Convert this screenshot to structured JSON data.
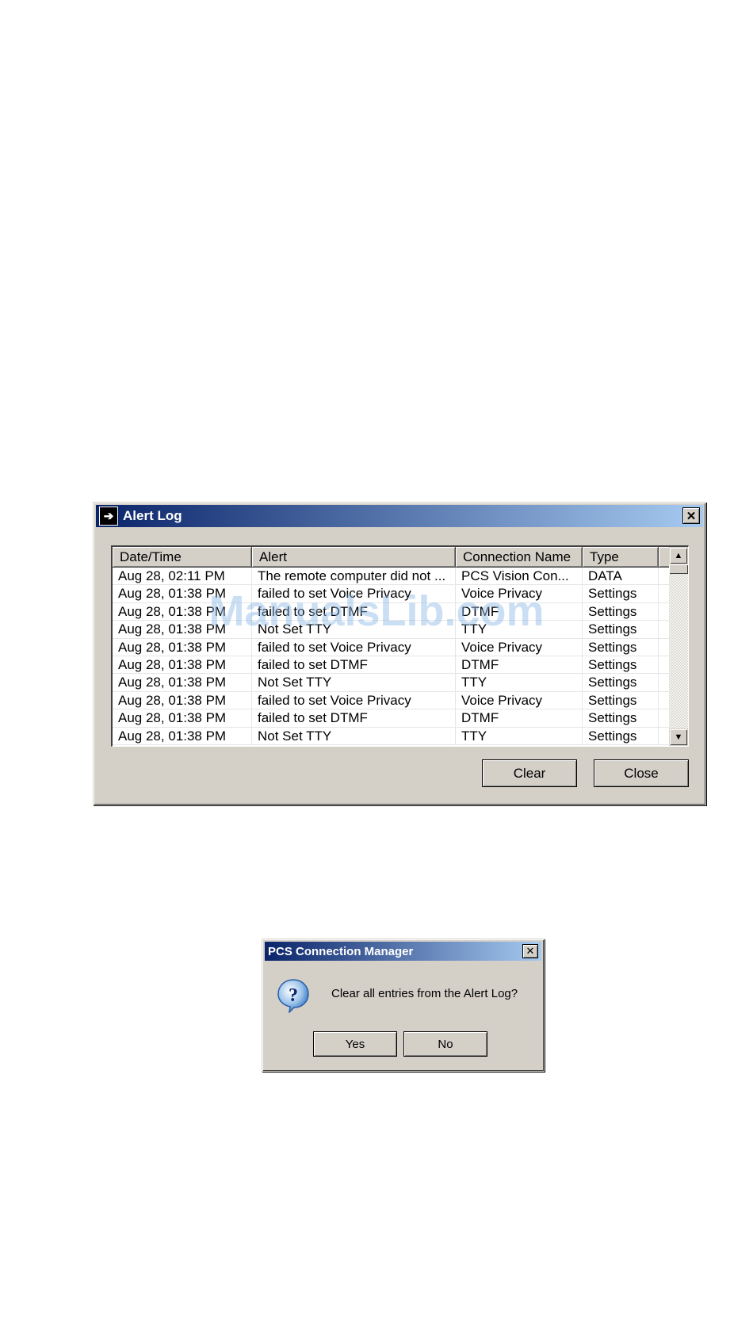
{
  "alert_log": {
    "title": "Alert Log",
    "close_glyph": "✕",
    "columns": [
      "Date/Time",
      "Alert",
      "Connection Name",
      "Type"
    ],
    "rows": [
      [
        "Aug  28, 02:11 PM",
        "The remote computer did not ...",
        "PCS Vision Con...",
        "DATA"
      ],
      [
        "Aug  28, 01:38 PM",
        "failed to set Voice Privacy",
        "Voice Privacy",
        "Settings"
      ],
      [
        "Aug  28, 01:38 PM",
        "failed to set DTMF",
        "DTMF",
        "Settings"
      ],
      [
        "Aug  28, 01:38 PM",
        "Not Set TTY",
        "TTY",
        "Settings"
      ],
      [
        "Aug  28, 01:38 PM",
        "failed to set Voice Privacy",
        "Voice Privacy",
        "Settings"
      ],
      [
        "Aug  28, 01:38 PM",
        "failed to set DTMF",
        "DTMF",
        "Settings"
      ],
      [
        "Aug  28, 01:38 PM",
        "Not Set TTY",
        "TTY",
        "Settings"
      ],
      [
        "Aug  28, 01:38 PM",
        "failed to set Voice Privacy",
        "Voice Privacy",
        "Settings"
      ],
      [
        "Aug  28, 01:38 PM",
        "failed to set DTMF",
        "DTMF",
        "Settings"
      ],
      [
        "Aug  28, 01:38 PM",
        "Not Set TTY",
        "TTY",
        "Settings"
      ]
    ],
    "clear_label": "Clear",
    "close_label": "Close"
  },
  "watermark": "ManualsLib.com",
  "confirm": {
    "title": "PCS Connection Manager",
    "message": "Clear all entries from the Alert Log?",
    "yes_label": "Yes",
    "no_label": "No",
    "close_glyph": "✕"
  },
  "colors": {
    "title_start": "#0a246a",
    "title_end": "#a6caf0",
    "face": "#d4d0c8"
  },
  "icons": {
    "app": "arrow-exit-icon",
    "question": "question-icon"
  }
}
